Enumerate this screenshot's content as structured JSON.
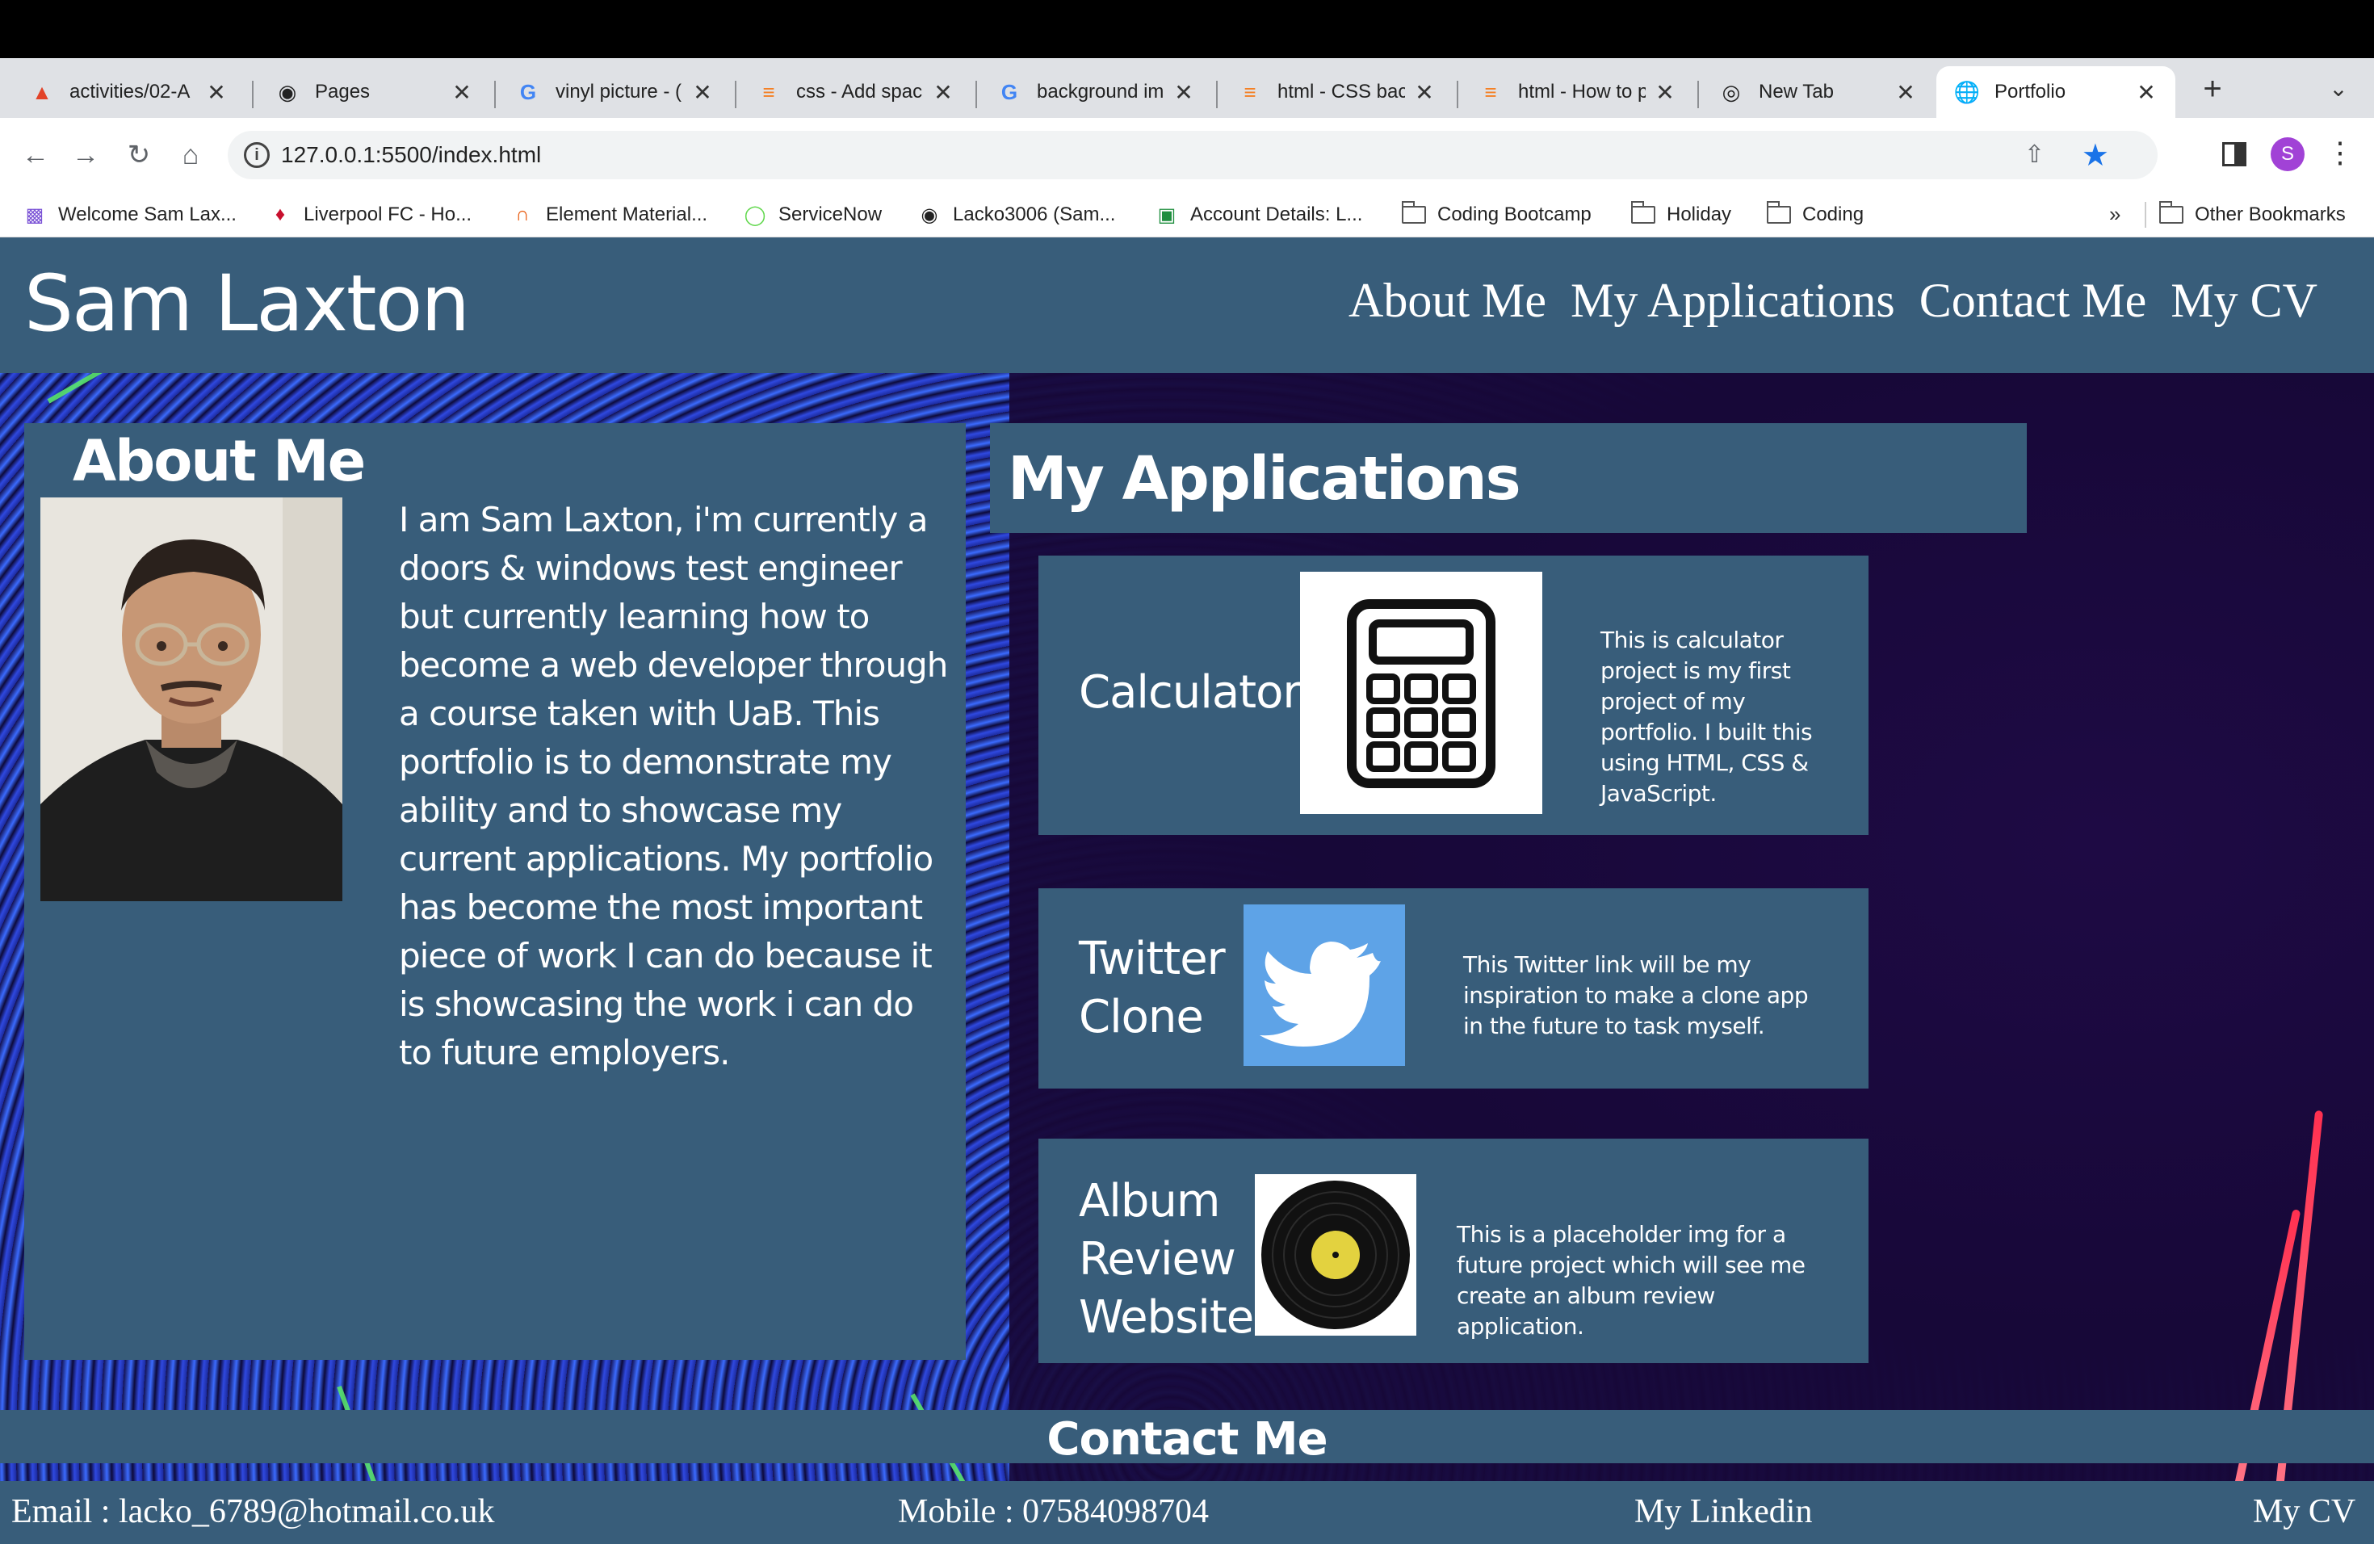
{
  "browser": {
    "tabs": [
      {
        "title": "activities/02-A",
        "icon": "gitlab-icon"
      },
      {
        "title": "Pages",
        "icon": "github-icon"
      },
      {
        "title": "vinyl picture - (",
        "icon": "google-icon"
      },
      {
        "title": "css - Add spac",
        "icon": "stackoverflow-icon"
      },
      {
        "title": "background im",
        "icon": "google-icon"
      },
      {
        "title": "html - CSS bac",
        "icon": "stackoverflow-icon"
      },
      {
        "title": "html - How to p",
        "icon": "stackoverflow-icon"
      },
      {
        "title": "New Tab",
        "icon": "chrome-icon"
      },
      {
        "title": "Portfolio",
        "icon": "globe-icon"
      }
    ],
    "url": "127.0.0.1:5500/index.html",
    "profile_initial": "S",
    "bookmarks": [
      {
        "label": "Welcome Sam Lax...",
        "icon": "bookmark-app-icon"
      },
      {
        "label": "Liverpool FC - Ho...",
        "icon": "liverpool-icon"
      },
      {
        "label": "Element Material...",
        "icon": "element-icon"
      },
      {
        "label": "ServiceNow",
        "icon": "servicenow-icon"
      },
      {
        "label": "Lacko3006 (Sam...",
        "icon": "github-icon"
      },
      {
        "label": "Account Details: L...",
        "icon": "account-icon"
      },
      {
        "label": "Coding Bootcamp",
        "icon": "folder-icon"
      },
      {
        "label": "Holiday",
        "icon": "folder-icon"
      },
      {
        "label": "Coding",
        "icon": "folder-icon"
      }
    ],
    "bookmarks_overflow": "»",
    "other_bookmarks": "Other Bookmarks"
  },
  "site": {
    "title": "Sam Laxton",
    "nav": [
      "About Me",
      "My Applications",
      "Contact Me",
      "My CV"
    ],
    "about": {
      "title": "About Me",
      "text": "I am Sam Laxton, i'm currently a doors & windows test engineer but currently learning how to become a web developer through a course taken with UaB. This portfolio is to demonstrate my ability and to showcase my current applications. My portfolio has become the most important piece of work I can do because it is showcasing the work i can do to future employers."
    },
    "applications": {
      "title": "My Applications",
      "items": [
        {
          "name": "Calculator",
          "description": "This is calculator project is my first project of my portfolio. I built this using HTML, CSS & JavaScript.",
          "icon": "calculator-icon"
        },
        {
          "name": "Twitter Clone",
          "description": "This Twitter link will be my inspiration to make a clone app in the future to task myself.",
          "icon": "twitter-icon"
        },
        {
          "name": "Album Review Website",
          "description": "This is a placeholder img for a future project which will see me create an album review application.",
          "icon": "vinyl-record-icon"
        }
      ]
    },
    "contact": {
      "title": "Contact Me",
      "email": "Email : lacko_6789@hotmail.co.uk",
      "mobile": "Mobile : 07584098704",
      "linkedin": "My Linkedin",
      "cv": "My CV"
    },
    "colors": {
      "panel": "#385d7a",
      "accent_link": "#ffffff"
    }
  }
}
